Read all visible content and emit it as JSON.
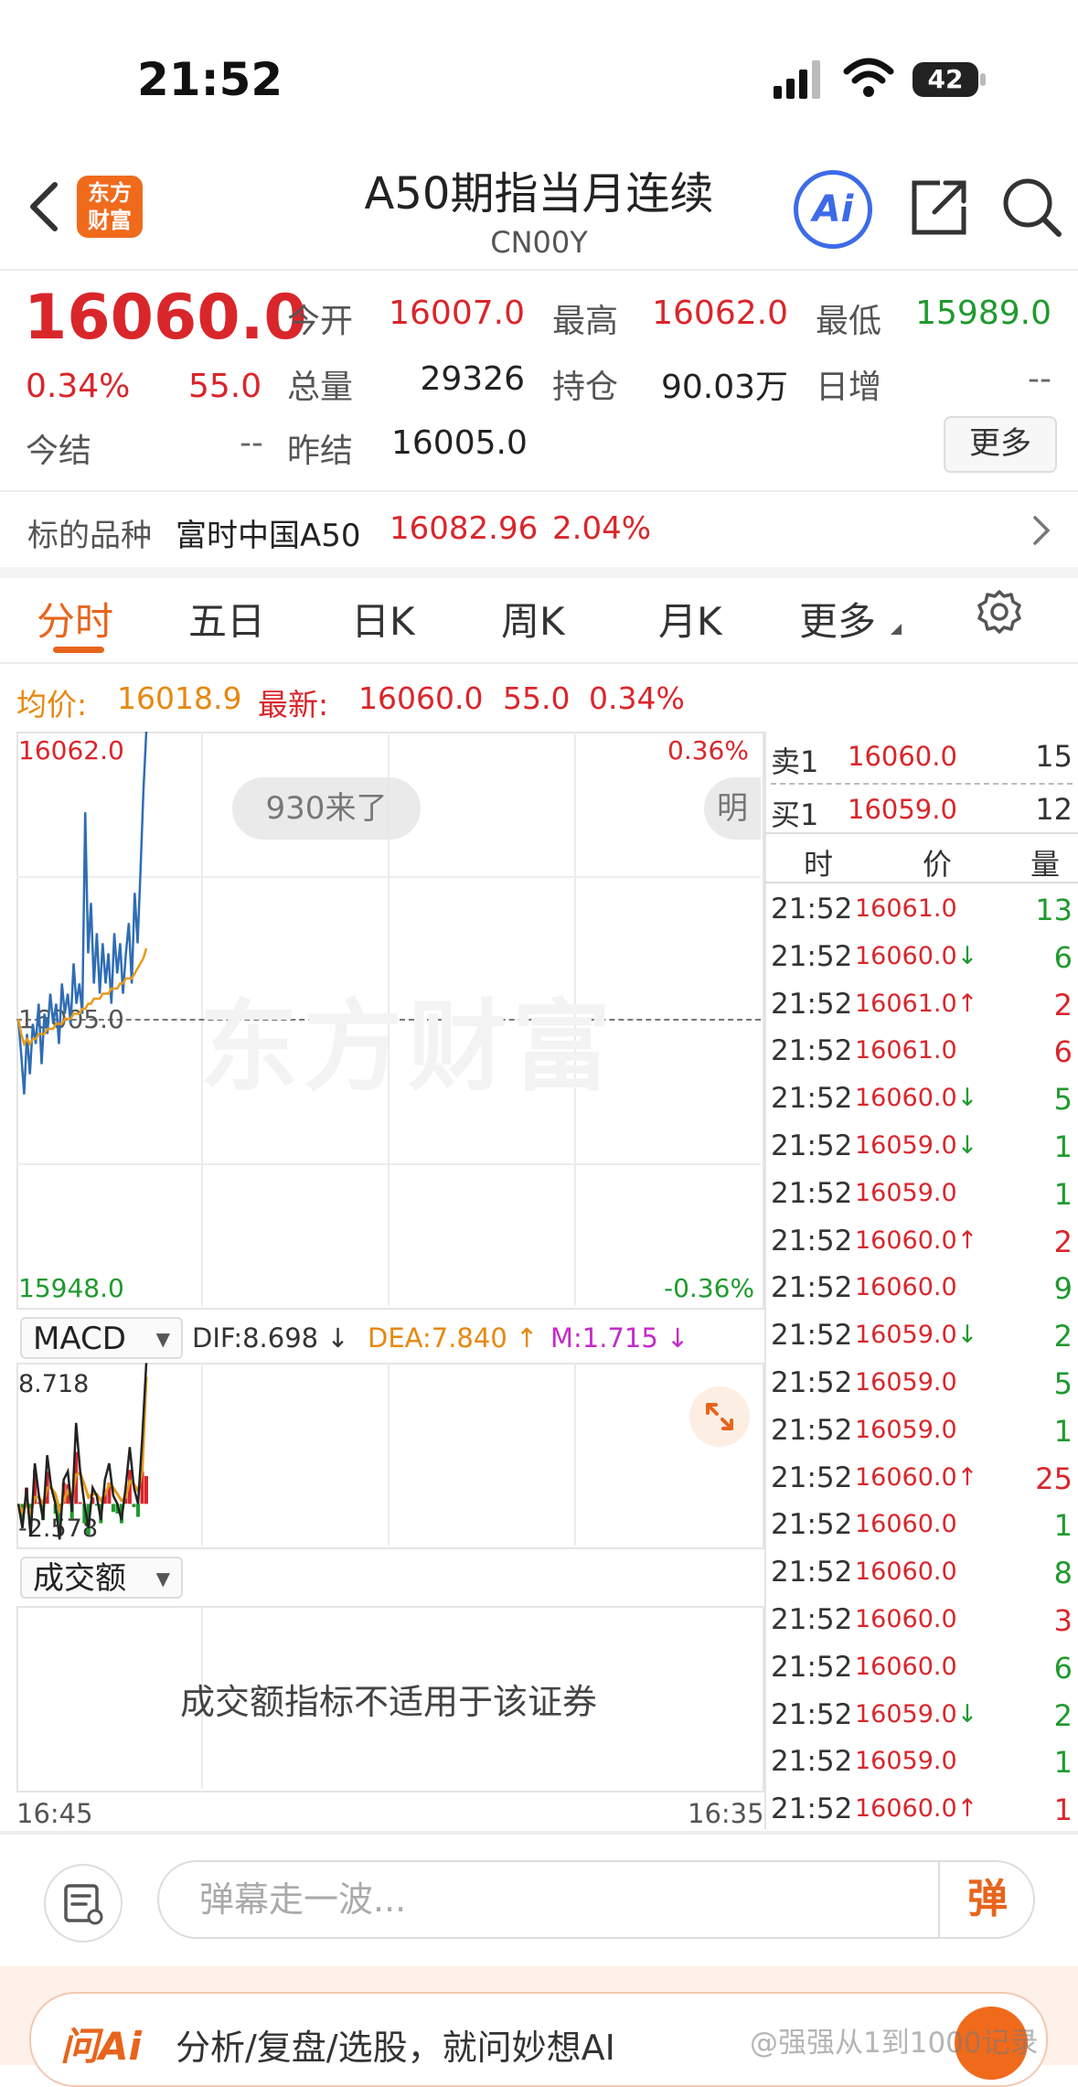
{
  "status": {
    "time": "21:52",
    "battery": "42"
  },
  "header": {
    "title": "A50期指当月连续",
    "code": "CN00Y",
    "logo": "东方\n财富",
    "ai": "Ai"
  },
  "quote": {
    "last": "16060.0",
    "change_pct": "0.34%",
    "change": "55.0",
    "open_label": "今开",
    "open": "16007.0",
    "high_label": "最高",
    "high": "16062.0",
    "low_label": "最低",
    "low": "15989.0",
    "volume_label": "总量",
    "volume": "29326",
    "oi_label": "持仓",
    "oi": "90.03万",
    "daily_inc_label": "日增",
    "daily_inc": "--",
    "settle_label": "今结",
    "settle": "--",
    "prev_settle_label": "昨结",
    "prev_settle": "16005.0",
    "more": "更多"
  },
  "underlying": {
    "label": "标的品种",
    "name": "富时中国A50",
    "price": "16082.96",
    "pct": "2.04%"
  },
  "tabs": [
    "分时",
    "五日",
    "日K",
    "周K",
    "月K",
    "更多"
  ],
  "info_line": {
    "avg_label": "均价:",
    "avg": "16018.9",
    "latest_label": "最新:",
    "latest": "16060.0",
    "chg": "55.0",
    "pct": "0.34%"
  },
  "chart": {
    "y_top": "16062.0",
    "y_bottom": "15948.0",
    "y_mid": "16005.0",
    "pct_top": "0.36%",
    "pct_bottom": "-0.36%",
    "bubble1": "930来了",
    "bubble2": "明",
    "watermark": "东方财富",
    "x_start": "16:45",
    "x_end": "16:35"
  },
  "chart_data": {
    "type": "line",
    "title": "",
    "xlabel": "",
    "ylabel": "",
    "ylim": [
      15948.0,
      16062.0
    ],
    "reference": 16005.0,
    "series": [
      {
        "values": [
          16005,
          15998,
          15990,
          16002,
          15994,
          16004,
          16000,
          16008,
          15996,
          16006,
          16002,
          16010,
          16004,
          16008,
          16000,
          16012,
          16006,
          16010,
          16004,
          16016,
          16008,
          16012,
          16006,
          16046,
          16018,
          16028,
          16012,
          16022,
          16010,
          16020,
          16012,
          16018,
          16008,
          16022,
          16014,
          16020,
          16010,
          16018,
          16024,
          16012,
          16030,
          16020,
          16034,
          16050,
          16062
        ]
      },
      {
        "values": [
          16005,
          16002,
          16000,
          16001,
          16000,
          16001,
          16001,
          16002,
          16002,
          16002,
          16003,
          16003,
          16003,
          16004,
          16004,
          16004,
          16005,
          16005,
          16005,
          16006,
          16006,
          16006,
          16007,
          16007,
          16008,
          16008,
          16009,
          16009,
          16009,
          16010,
          16010,
          16010,
          16011,
          16011,
          16011,
          16012,
          16012,
          16013,
          16013,
          16013,
          16014,
          16015,
          16016,
          16017,
          16019
        ]
      }
    ],
    "macd": {
      "dif": "DIF:8.698",
      "dea": "DEA:7.840",
      "m": "M:1.715",
      "top": "8.718",
      "bottom": "-2.578",
      "ylim": [
        -2.578,
        8.718
      ],
      "dif_values": [
        0.0,
        -1.5,
        1.0,
        -2.0,
        2.5,
        0.5,
        -1.0,
        3.0,
        1.0,
        0.0,
        -2.2,
        1.5,
        2.0,
        -0.5,
        5.0,
        2.0,
        0.0,
        -1.5,
        1.0,
        0.5,
        -1.0,
        1.5,
        2.5,
        0.5,
        0.0,
        -1.0,
        1.0,
        3.5,
        1.0,
        0.0,
        4.0,
        8.698
      ],
      "dea_values": [
        0.0,
        -0.5,
        0.0,
        -0.6,
        0.4,
        0.4,
        0.0,
        1.0,
        1.0,
        0.6,
        -0.4,
        0.2,
        0.8,
        0.4,
        1.8,
        1.9,
        1.2,
        0.4,
        0.6,
        0.6,
        0.2,
        0.6,
        1.2,
        1.0,
        0.6,
        0.2,
        0.4,
        1.4,
        1.2,
        0.8,
        2.0,
        7.84
      ],
      "hist_values": [
        0.0,
        -1.0,
        1.0,
        -1.4,
        2.1,
        0.1,
        -1.0,
        2.0,
        0.0,
        -0.6,
        -1.8,
        1.3,
        1.2,
        -0.9,
        3.2,
        0.1,
        -1.2,
        -1.9,
        0.4,
        -0.1,
        -1.2,
        0.9,
        1.3,
        -0.5,
        -0.6,
        -1.2,
        0.6,
        2.1,
        -0.2,
        -0.8,
        2.0,
        1.715
      ]
    }
  },
  "indicators": {
    "macd_btn": "MACD",
    "turnover_btn": "成交额",
    "turnover_msg": "成交额指标不适用于该证券"
  },
  "orderbook": {
    "sell_label": "卖1",
    "sell_price": "16060.0",
    "sell_vol": "15",
    "buy_label": "买1",
    "buy_price": "16059.0",
    "buy_vol": "12",
    "col_time": "时",
    "col_price": "价",
    "col_vol": "量"
  },
  "ticks": [
    {
      "time": "21:52",
      "price": "16061.0",
      "dir": "",
      "vol": "13",
      "vol_color": "green"
    },
    {
      "time": "21:52",
      "price": "16060.0",
      "dir": "↓",
      "vol": "6",
      "vol_color": "green"
    },
    {
      "time": "21:52",
      "price": "16061.0",
      "dir": "↑",
      "vol": "2",
      "vol_color": "red"
    },
    {
      "time": "21:52",
      "price": "16061.0",
      "dir": "",
      "vol": "6",
      "vol_color": "red"
    },
    {
      "time": "21:52",
      "price": "16060.0",
      "dir": "↓",
      "vol": "5",
      "vol_color": "green"
    },
    {
      "time": "21:52",
      "price": "16059.0",
      "dir": "↓",
      "vol": "1",
      "vol_color": "green"
    },
    {
      "time": "21:52",
      "price": "16059.0",
      "dir": "",
      "vol": "1",
      "vol_color": "green"
    },
    {
      "time": "21:52",
      "price": "16060.0",
      "dir": "↑",
      "vol": "2",
      "vol_color": "red"
    },
    {
      "time": "21:52",
      "price": "16060.0",
      "dir": "",
      "vol": "9",
      "vol_color": "green"
    },
    {
      "time": "21:52",
      "price": "16059.0",
      "dir": "↓",
      "vol": "2",
      "vol_color": "green"
    },
    {
      "time": "21:52",
      "price": "16059.0",
      "dir": "",
      "vol": "5",
      "vol_color": "green"
    },
    {
      "time": "21:52",
      "price": "16059.0",
      "dir": "",
      "vol": "1",
      "vol_color": "green"
    },
    {
      "time": "21:52",
      "price": "16060.0",
      "dir": "↑",
      "vol": "25",
      "vol_color": "red"
    },
    {
      "time": "21:52",
      "price": "16060.0",
      "dir": "",
      "vol": "1",
      "vol_color": "green"
    },
    {
      "time": "21:52",
      "price": "16060.0",
      "dir": "",
      "vol": "8",
      "vol_color": "green"
    },
    {
      "time": "21:52",
      "price": "16060.0",
      "dir": "",
      "vol": "3",
      "vol_color": "red"
    },
    {
      "time": "21:52",
      "price": "16060.0",
      "dir": "",
      "vol": "6",
      "vol_color": "green"
    },
    {
      "time": "21:52",
      "price": "16059.0",
      "dir": "↓",
      "vol": "2",
      "vol_color": "green"
    },
    {
      "time": "21:52",
      "price": "16059.0",
      "dir": "",
      "vol": "1",
      "vol_color": "green"
    },
    {
      "time": "21:52",
      "price": "16060.0",
      "dir": "↑",
      "vol": "1",
      "vol_color": "red"
    }
  ],
  "bottom": {
    "danmu_placeholder": "弹幕走一波...",
    "danmu_btn": "弹",
    "ai_brand": "问Ai",
    "ai_text": "分析/复盘/选股，就问妙想AI",
    "watermark": "@强强从1到1000记录"
  },
  "colors": {
    "up": "#d9262b",
    "down": "#1f9a2e",
    "accent": "#e8641c",
    "price_line": "#2f6db5",
    "avg_line": "#e89a1a"
  }
}
